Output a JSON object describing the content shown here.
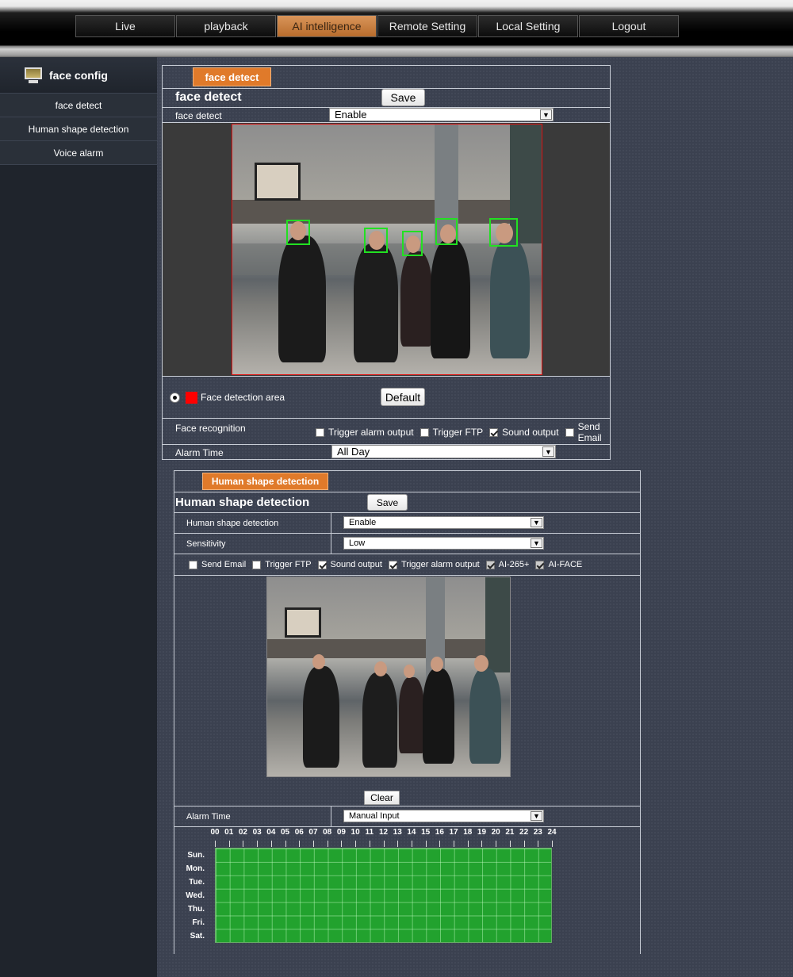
{
  "nav": {
    "tabs": [
      {
        "label": "Live",
        "active": false
      },
      {
        "label": "playback",
        "active": false
      },
      {
        "label": "AI intelligence",
        "active": true
      },
      {
        "label": "Remote Setting",
        "active": false
      },
      {
        "label": "Local Setting",
        "active": false
      },
      {
        "label": "Logout",
        "active": false
      }
    ]
  },
  "sidebar": {
    "title": "face config",
    "icon": "monitor-icon",
    "items": [
      {
        "label": "face detect"
      },
      {
        "label": "Human shape detection"
      },
      {
        "label": "Voice alarm"
      }
    ]
  },
  "face": {
    "tab": "face detect",
    "heading": "face detect",
    "save": "Save",
    "enable_label": "face detect",
    "enable_value": "Enable",
    "area_label": "Face detection area",
    "area_color": "#ff0000",
    "default_btn": "Default",
    "recog_label": "Face recognition",
    "options": [
      {
        "label": "Trigger alarm output",
        "checked": false
      },
      {
        "label": "Trigger FTP",
        "checked": false
      },
      {
        "label": "Sound output",
        "checked": true
      },
      {
        "label": "Send Email",
        "checked": false
      }
    ],
    "alarm_time_label": "Alarm Time",
    "alarm_time_value": "All Day"
  },
  "human": {
    "tab": "Human shape detection",
    "heading": "Human shape detection",
    "save": "Save",
    "enable_label": "Human shape detection",
    "enable_value": "Enable",
    "sensitivity_label": "Sensitivity",
    "sensitivity_value": "Low",
    "options": [
      {
        "label": "Send Email",
        "checked": false
      },
      {
        "label": "Trigger FTP",
        "checked": false
      },
      {
        "label": "Sound output",
        "checked": true
      },
      {
        "label": "Trigger alarm output",
        "checked": true
      },
      {
        "label": "AI-265+",
        "checked": true
      },
      {
        "label": "AI-FACE",
        "checked": true
      }
    ],
    "clear_btn": "Clear",
    "alarm_time_label": "Alarm Time",
    "alarm_time_value": "Manual Input",
    "hours": [
      "00",
      "01",
      "02",
      "03",
      "04",
      "05",
      "06",
      "07",
      "08",
      "09",
      "10",
      "11",
      "12",
      "13",
      "14",
      "15",
      "16",
      "17",
      "18",
      "19",
      "20",
      "21",
      "22",
      "23",
      "24"
    ],
    "days": [
      "Sun.",
      "Mon.",
      "Tue.",
      "Wed.",
      "Thu.",
      "Fri.",
      "Sat."
    ],
    "grid_color": "#22a22e"
  }
}
